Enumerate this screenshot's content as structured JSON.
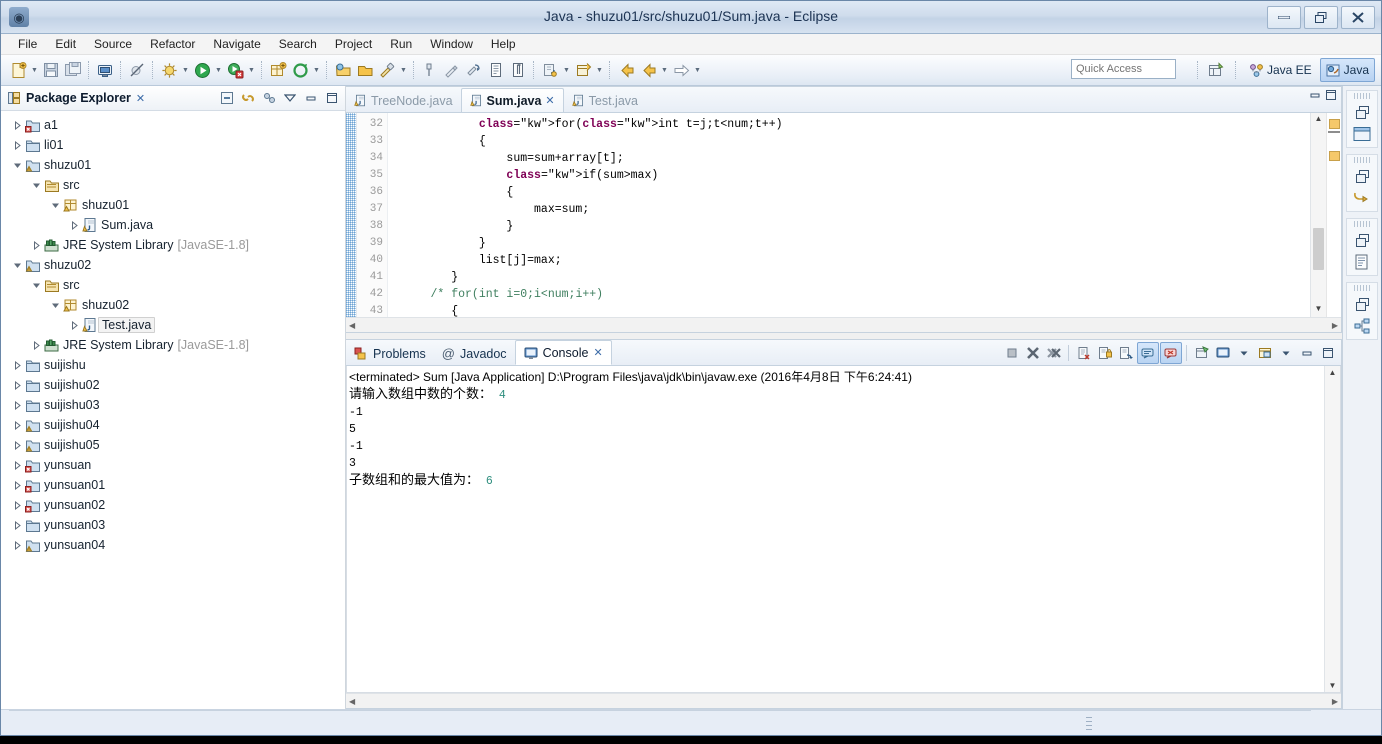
{
  "window": {
    "title": "Java - shuzu01/src/shuzu01/Sum.java - Eclipse",
    "minimize_label": "–",
    "maximize_label": "❐",
    "close_label": "✕"
  },
  "menubar": {
    "items": [
      "File",
      "Edit",
      "Source",
      "Refactor",
      "Navigate",
      "Search",
      "Project",
      "Run",
      "Window",
      "Help"
    ]
  },
  "toolbar": {
    "quick_access_placeholder": "Quick Access",
    "buttons": [
      {
        "name": "new-wizard",
        "icon": "new-file-icon",
        "dropdown": true
      },
      {
        "name": "save",
        "icon": "save-icon",
        "dropdown": false
      },
      {
        "name": "save-all",
        "icon": "save-all-icon",
        "dropdown": false
      },
      {
        "name": "print",
        "icon": "print-icon",
        "dropdown": false
      },
      {
        "name": "toggle-breakpoint",
        "icon": "breakpoint-off-icon",
        "dropdown": false
      },
      {
        "name": "debug",
        "icon": "debug-icon",
        "dropdown": true
      },
      {
        "name": "run",
        "icon": "run-icon",
        "dropdown": true
      },
      {
        "name": "run-external-tools",
        "icon": "external-tools-icon",
        "dropdown": true
      },
      {
        "name": "new-java-package",
        "icon": "new-package-icon",
        "dropdown": false
      },
      {
        "name": "new-java-class",
        "icon": "new-class-icon",
        "dropdown": true
      },
      {
        "name": "open-type",
        "icon": "open-type-icon",
        "dropdown": false
      },
      {
        "name": "open-task",
        "icon": "open-task-icon",
        "dropdown": false
      },
      {
        "name": "search",
        "icon": "search-icon",
        "dropdown": true
      },
      {
        "name": "next-annotation-marker",
        "icon": "pin-icon",
        "dropdown": false
      },
      {
        "name": "previous-edit",
        "icon": "pencil-icon",
        "dropdown": false
      },
      {
        "name": "last-edit-location",
        "icon": "last-edit-icon",
        "dropdown": false
      },
      {
        "name": "show-whitespace",
        "icon": "whitespace-icon",
        "dropdown": false
      },
      {
        "name": "toggle-mark-occurrences",
        "icon": "paragraph-icon",
        "dropdown": false
      },
      {
        "name": "step-over",
        "icon": "step-icon",
        "dropdown": true
      },
      {
        "name": "new-editor",
        "icon": "new-editor-icon",
        "dropdown": true
      },
      {
        "name": "back-history",
        "icon": "back-arrow-icon",
        "dropdown": false
      },
      {
        "name": "forward-history",
        "icon": "forward-arrow-icon",
        "dropdown": true
      },
      {
        "name": "next-arrow",
        "icon": "right-arrow-icon",
        "dropdown": true
      }
    ],
    "perspective": {
      "open_label": "",
      "items": [
        {
          "label": "Java EE",
          "icon": "java-ee-perspective-icon",
          "active": false
        },
        {
          "label": "Java",
          "icon": "java-perspective-icon",
          "active": true
        }
      ]
    }
  },
  "package_explorer": {
    "title": "Package Explorer",
    "close_label": "✕",
    "toolbar": [
      {
        "name": "collapse-all-icon"
      },
      {
        "name": "link-with-editor-icon"
      },
      {
        "name": "focus-on-active-task-icon"
      },
      {
        "name": "view-menu-icon"
      },
      {
        "name": "minimize-view-icon"
      },
      {
        "name": "maximize-view-icon"
      }
    ],
    "tree": [
      {
        "label": "a1",
        "indent": 0,
        "twisty": "collapsed",
        "icon": "project-error-icon",
        "dim": ""
      },
      {
        "label": "li01",
        "indent": 0,
        "twisty": "collapsed",
        "icon": "project-icon",
        "dim": ""
      },
      {
        "label": "shuzu01",
        "indent": 0,
        "twisty": "expanded",
        "icon": "project-warning-icon",
        "dim": ""
      },
      {
        "label": "src",
        "indent": 1,
        "twisty": "expanded",
        "icon": "source-folder-icon",
        "dim": ""
      },
      {
        "label": "shuzu01",
        "indent": 2,
        "twisty": "expanded",
        "icon": "package-warning-icon",
        "dim": ""
      },
      {
        "label": "Sum.java",
        "indent": 3,
        "twisty": "collapsed",
        "icon": "java-file-icon",
        "dim": ""
      },
      {
        "label": "JRE System Library",
        "indent": 1,
        "twisty": "collapsed",
        "icon": "library-icon",
        "dim": "[JavaSE-1.8]"
      },
      {
        "label": "shuzu02",
        "indent": 0,
        "twisty": "expanded",
        "icon": "project-warning-icon",
        "dim": ""
      },
      {
        "label": "src",
        "indent": 1,
        "twisty": "expanded",
        "icon": "source-folder-icon",
        "dim": ""
      },
      {
        "label": "shuzu02",
        "indent": 2,
        "twisty": "expanded",
        "icon": "package-warning-icon",
        "dim": ""
      },
      {
        "label": "Test.java",
        "indent": 3,
        "twisty": "collapsed",
        "icon": "java-file-icon",
        "dim": "",
        "selected": true
      },
      {
        "label": "JRE System Library",
        "indent": 1,
        "twisty": "collapsed",
        "icon": "library-icon",
        "dim": "[JavaSE-1.8]"
      },
      {
        "label": "suijishu",
        "indent": 0,
        "twisty": "collapsed",
        "icon": "project-icon",
        "dim": ""
      },
      {
        "label": "suijishu02",
        "indent": 0,
        "twisty": "collapsed",
        "icon": "project-icon",
        "dim": ""
      },
      {
        "label": "suijishu03",
        "indent": 0,
        "twisty": "collapsed",
        "icon": "project-icon",
        "dim": ""
      },
      {
        "label": "suijishu04",
        "indent": 0,
        "twisty": "collapsed",
        "icon": "project-warning-icon",
        "dim": ""
      },
      {
        "label": "suijishu05",
        "indent": 0,
        "twisty": "collapsed",
        "icon": "project-warning-icon",
        "dim": ""
      },
      {
        "label": "yunsuan",
        "indent": 0,
        "twisty": "collapsed",
        "icon": "project-error-icon",
        "dim": ""
      },
      {
        "label": "yunsuan01",
        "indent": 0,
        "twisty": "collapsed",
        "icon": "project-error-icon",
        "dim": ""
      },
      {
        "label": "yunsuan02",
        "indent": 0,
        "twisty": "collapsed",
        "icon": "project-error-icon",
        "dim": ""
      },
      {
        "label": "yunsuan03",
        "indent": 0,
        "twisty": "collapsed",
        "icon": "project-icon",
        "dim": ""
      },
      {
        "label": "yunsuan04",
        "indent": 0,
        "twisty": "collapsed",
        "icon": "project-warning-icon",
        "dim": ""
      }
    ]
  },
  "editor": {
    "tabs": [
      {
        "label": "TreeNode.java",
        "active": false,
        "closable": false
      },
      {
        "label": "Sum.java",
        "active": true,
        "closable": true,
        "close_label": "✕"
      },
      {
        "label": "Test.java",
        "active": false,
        "closable": false
      }
    ],
    "first_line": 32,
    "lines": [
      {
        "no": 32,
        "text": "            for(int t=j;t<num;t++)"
      },
      {
        "no": 33,
        "text": "            {"
      },
      {
        "no": 34,
        "text": "                sum=sum+array[t];"
      },
      {
        "no": 35,
        "text": "                if(sum>max)"
      },
      {
        "no": 36,
        "text": "                {"
      },
      {
        "no": 37,
        "text": "                    max=sum;"
      },
      {
        "no": 38,
        "text": "                }"
      },
      {
        "no": 39,
        "text": "            }"
      },
      {
        "no": 40,
        "text": "            list[j]=max;"
      },
      {
        "no": 41,
        "text": "        }"
      },
      {
        "no": 42,
        "text": "     /* for(int i=0;i<num;i++)"
      },
      {
        "no": 43,
        "text": "        {"
      }
    ],
    "minimize_label": "❐",
    "maximize_label": "☐"
  },
  "console_view": {
    "tabs": [
      {
        "label": "Problems",
        "icon": "problems-icon",
        "active": false
      },
      {
        "label": "Javadoc",
        "icon": "javadoc-icon",
        "active": false
      },
      {
        "label": "Console",
        "icon": "console-icon",
        "active": true,
        "close_label": "✕"
      }
    ],
    "toolbar": [
      {
        "name": "terminate-icon",
        "active": false
      },
      {
        "name": "remove-launch-icon",
        "active": false
      },
      {
        "name": "remove-all-terminated-icon",
        "active": false
      },
      {
        "name": "clear-console-icon",
        "active": false
      },
      {
        "name": "scroll-lock-icon",
        "active": false
      },
      {
        "name": "word-wrap-icon",
        "active": false
      },
      {
        "name": "show-console-on-output-icon",
        "active": true
      },
      {
        "name": "show-console-on-error-icon",
        "active": true
      },
      {
        "name": "pin-console-icon",
        "active": false
      },
      {
        "name": "display-selected-console-icon",
        "active": false
      },
      {
        "name": "open-console-icon",
        "active": false
      },
      {
        "name": "minimize-view-icon",
        "active": false
      },
      {
        "name": "maximize-view-icon",
        "active": false
      }
    ],
    "header_line": "<terminated> Sum [Java Application] D:\\Program Files\\java\\jdk\\bin\\javaw.exe (2016年4月8日 下午6:24:41)",
    "output_lines": [
      {
        "text": "请输入数组中数的个数：",
        "value": "4"
      },
      {
        "text": "-1",
        "value": ""
      },
      {
        "text": "5",
        "value": ""
      },
      {
        "text": "-1",
        "value": ""
      },
      {
        "text": "3",
        "value": ""
      },
      {
        "text": "子数组和的最大值为：",
        "value": "6"
      }
    ],
    "value_color": "#2f8f7f"
  },
  "fast_view_bar": {
    "groups": [
      {
        "restore_icon": "restore-view-icon",
        "view_icon": "editor-area-icon"
      },
      {
        "restore_icon": "restore-view-icon",
        "view_icon": "outline-view-icon"
      },
      {
        "restore_icon": "restore-view-icon",
        "view_icon": "task-list-icon"
      },
      {
        "restore_icon": "restore-view-icon",
        "view_icon": "hierarchy-view-icon"
      }
    ]
  },
  "status_bar": {
    "text": ""
  }
}
